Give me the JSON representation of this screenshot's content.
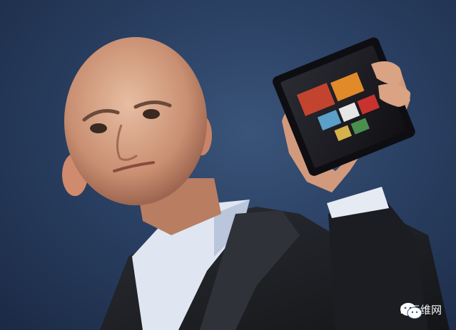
{
  "watermark": {
    "icon": "wechat-icon",
    "text": "IT运维网"
  },
  "colors": {
    "background": "#2a4063",
    "skin": "#d9a98c",
    "jacket": "#1e2024",
    "shirt": "#dfe6f2"
  }
}
